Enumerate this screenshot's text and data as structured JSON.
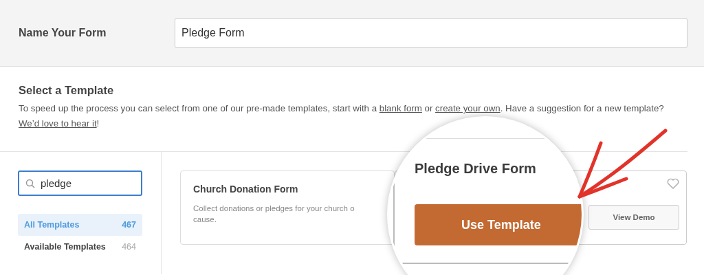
{
  "name_form": {
    "label": "Name Your Form",
    "value": "Pledge Form"
  },
  "template_section": {
    "title": "Select a Template",
    "description": [
      {
        "kind": "text",
        "text": "To speed up the process you can select from one of our pre-made templates, start with a "
      },
      {
        "kind": "link",
        "text": "blank form"
      },
      {
        "kind": "text",
        "text": " or "
      },
      {
        "kind": "link",
        "text": "create your own"
      },
      {
        "kind": "text",
        "text": ". Have a suggestion for a new template? "
      },
      {
        "kind": "link",
        "text": "We’d love to hear it"
      },
      {
        "kind": "text",
        "text": "!"
      }
    ]
  },
  "search": {
    "value": "pledge"
  },
  "categories": [
    {
      "label": "All Templates",
      "count": "467",
      "selected": true
    },
    {
      "label": "Available Templates",
      "count": "464",
      "selected": false
    }
  ],
  "templates": [
    {
      "kind": "card",
      "title": "Church Donation Form",
      "description": [
        "Collect donations or pledges for your church o",
        "cause."
      ]
    },
    {
      "kind": "actions",
      "button": "View Demo"
    }
  ],
  "magnifier": {
    "title": "Pledge Drive Form",
    "button": "Use Template"
  }
}
